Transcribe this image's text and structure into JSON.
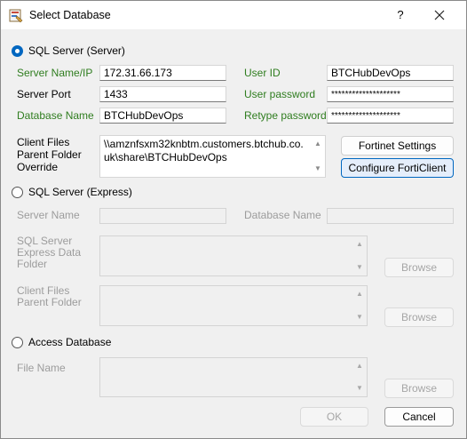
{
  "window": {
    "title": "Select Database",
    "help_glyph": "?",
    "close_glyph": "✕"
  },
  "sql_server": {
    "label": "SQL Server (Server)",
    "selected": true,
    "server_name_label": "Server Name/IP",
    "server_name_value": "172.31.66.173",
    "server_port_label": "Server Port",
    "server_port_value": "1433",
    "database_name_label": "Database Name",
    "database_name_value": "BTCHubDevOps",
    "user_id_label": "User ID",
    "user_id_value": "BTCHubDevOps",
    "user_password_label": "User password",
    "user_password_value": "********************",
    "retype_password_label": "Retype password",
    "retype_password_value": "********************",
    "client_files_label": "Client Files Parent Folder Override",
    "client_files_value": "\\\\amznfsxm32knbtm.customers.btchub.co.uk\\share\\BTCHubDevOps",
    "fortinet_settings_label": "Fortinet Settings",
    "configure_forticlient_label": "Configure FortiClient"
  },
  "sql_express": {
    "label": "SQL Server (Express)",
    "selected": false,
    "server_name_label": "Server Name",
    "server_name_value": "",
    "database_name_label": "Database Name",
    "database_name_value": "",
    "data_folder_label": "SQL Server Express Data Folder",
    "data_folder_value": "",
    "data_folder_browse_label": "Browse",
    "client_files_label": "Client Files Parent Folder",
    "client_files_value": "",
    "client_files_browse_label": "Browse"
  },
  "access": {
    "label": "Access Database",
    "selected": false,
    "file_name_label": "File Name",
    "file_name_value": "",
    "browse_label": "Browse"
  },
  "footer": {
    "ok_label": "OK",
    "cancel_label": "Cancel"
  },
  "colors": {
    "accent": "#0067c0",
    "required_label": "#2f7d1f",
    "disabled_text": "#9c9c9c"
  }
}
